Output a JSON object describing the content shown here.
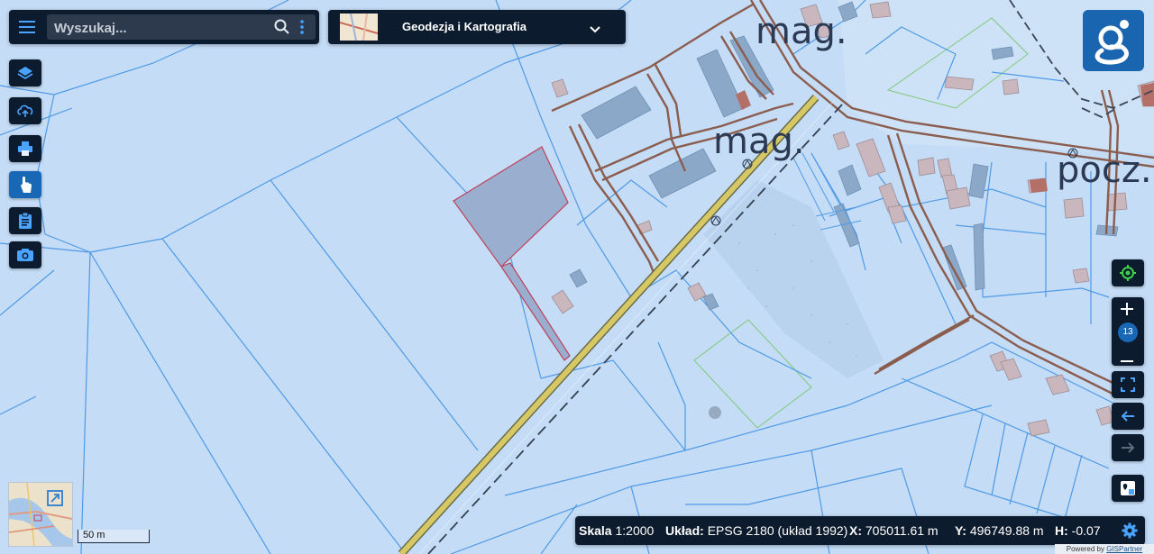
{
  "search": {
    "placeholder": "Wyszukaj..."
  },
  "layer_selector": {
    "title": "Geodezja i Kartografia"
  },
  "map_labels": {
    "label_1": "mag.",
    "label_2": "mag.",
    "label_3": "pocz."
  },
  "zoom": {
    "level": "13"
  },
  "scale_bar": {
    "label": "50 m"
  },
  "status_bar": {
    "scale_label": "Skala",
    "scale_value": "1:2000",
    "system_label": "Układ:",
    "system_value": "EPSG 2180 (układ 1992)",
    "x_label": "X:",
    "x_value": "705011.61 m",
    "y_label": "Y:",
    "y_value": "496749.88 m",
    "h_label": "H:",
    "h_value": "-0.07"
  },
  "footer": {
    "powered_prefix": "Powered by ",
    "powered_brand": "GISPartner"
  },
  "colors": {
    "panel": "#0d1b2e",
    "accent": "#1868b5",
    "map_background": "#c4dcf6",
    "parcel_line": "#4f9ae6",
    "road": "#8b5d4e",
    "highlight": "#9aaed0"
  },
  "icons": [
    "menu-icon",
    "search-icon",
    "more-icon",
    "chevron-down-icon",
    "layers-icon",
    "cloud-icon",
    "print-icon",
    "touch-icon",
    "clipboard-icon",
    "camera-icon",
    "locate-icon",
    "fullscreen-icon",
    "arrow-left-icon",
    "arrow-right-icon",
    "map-pin-icon",
    "settings-icon",
    "expand-icon"
  ]
}
